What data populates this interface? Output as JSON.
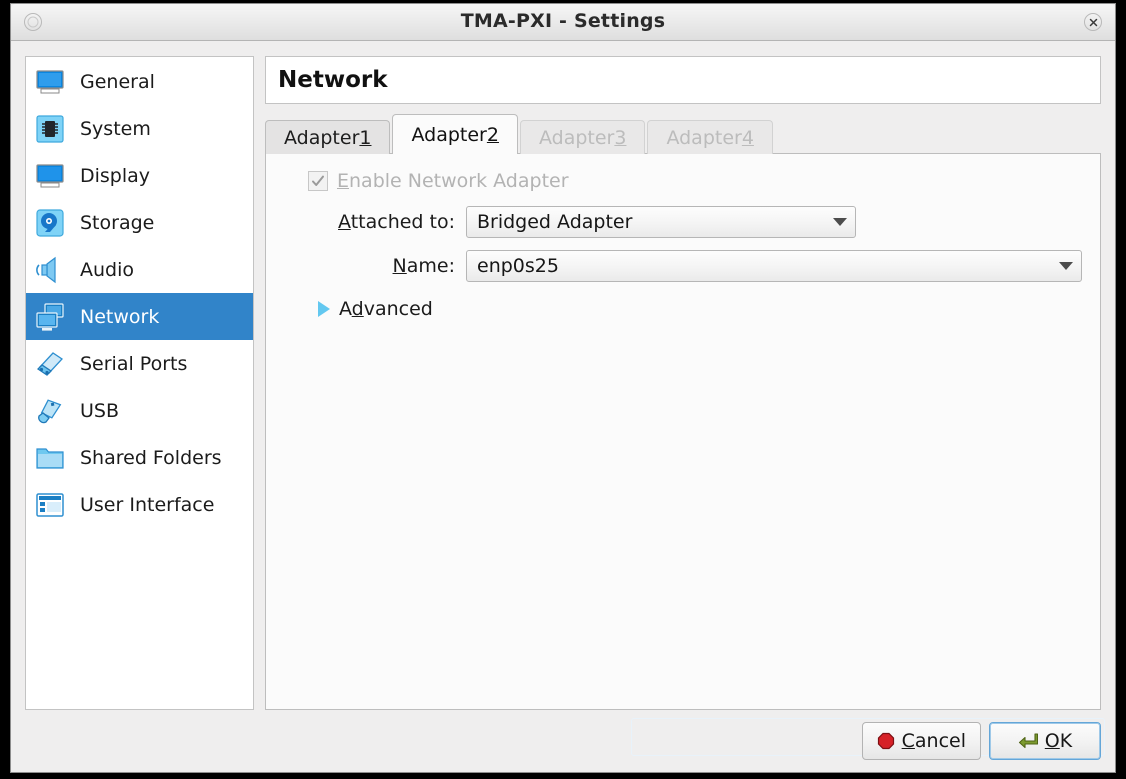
{
  "window": {
    "title": "TMA-PXI - Settings",
    "menu_button_icon": "window-menu-icon",
    "close_button_icon": "close-icon"
  },
  "sidebar": {
    "items": [
      {
        "label": "General",
        "icon": "monitor-general-icon",
        "selected": false
      },
      {
        "label": "System",
        "icon": "cpu-chip-icon",
        "selected": false
      },
      {
        "label": "Display",
        "icon": "monitor-display-icon",
        "selected": false
      },
      {
        "label": "Storage",
        "icon": "hard-disk-icon",
        "selected": false
      },
      {
        "label": "Audio",
        "icon": "speaker-icon",
        "selected": false
      },
      {
        "label": "Network",
        "icon": "network-monitors-icon",
        "selected": true
      },
      {
        "label": "Serial Ports",
        "icon": "serial-port-icon",
        "selected": false
      },
      {
        "label": "USB",
        "icon": "usb-plug-icon",
        "selected": false
      },
      {
        "label": "Shared Folders",
        "icon": "folder-icon",
        "selected": false
      },
      {
        "label": "User Interface",
        "icon": "window-layout-icon",
        "selected": false
      }
    ]
  },
  "page": {
    "title": "Network"
  },
  "tabs": [
    {
      "label": "Adapter ",
      "mnemonic": "1",
      "state": "inactive"
    },
    {
      "label": "Adapter ",
      "mnemonic": "2",
      "state": "active"
    },
    {
      "label": "Adapter ",
      "mnemonic": "3",
      "state": "disabled"
    },
    {
      "label": "Adapter ",
      "mnemonic": "4",
      "state": "disabled"
    }
  ],
  "form": {
    "enable_adapter": {
      "label_pre": "",
      "label_mnemonic": "E",
      "label_post": "nable Network Adapter",
      "checked": true,
      "disabled": true,
      "check_glyph": "checkmark-icon"
    },
    "attached_to": {
      "label_pre": "",
      "label_mnemonic": "A",
      "label_post": "ttached to:",
      "value": "Bridged Adapter"
    },
    "name": {
      "label_pre": "",
      "label_mnemonic": "N",
      "label_post": "ame:",
      "value": "enp0s25"
    },
    "advanced": {
      "label_pre": "A",
      "label_mnemonic": "d",
      "label_post": "vanced",
      "expanded": false,
      "disclosure_icon": "triangle-right-icon"
    }
  },
  "footer": {
    "cancel": {
      "label_pre": "",
      "label_mnemonic": "C",
      "label_post": "ancel",
      "icon": "stop-sign-icon"
    },
    "ok": {
      "label_pre": "",
      "label_mnemonic": "O",
      "label_post": "K",
      "icon": "enter-arrow-icon",
      "focused": true
    }
  },
  "colors": {
    "selection_blue": "#3184c9",
    "disclosure_blue": "#63c8f0",
    "cancel_red": "#d62127",
    "ok_green": "#6b8e23",
    "window_bg": "#efeeee"
  }
}
